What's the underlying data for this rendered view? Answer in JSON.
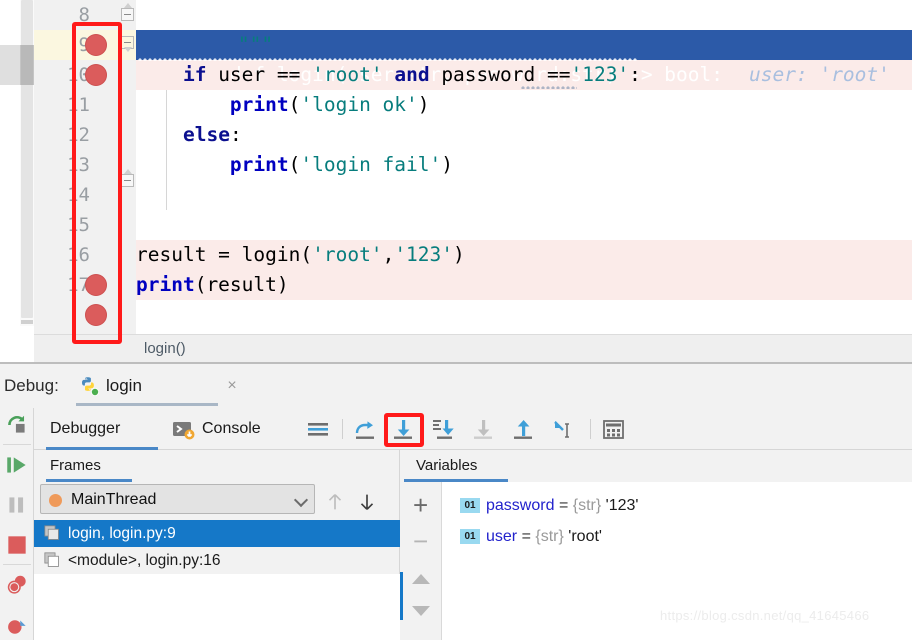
{
  "editor": {
    "lines": [
      {
        "num": "8",
        "text": "\"\"\"",
        "breakpoint": false,
        "state": "normal"
      },
      {
        "num": "9",
        "text": "def login(user:str, password:str) -> bool:",
        "breakpoint": true,
        "state": "executing",
        "inline_hint": "user: 'root'"
      },
      {
        "num": "10",
        "text": "    if user == 'root' and password =='123':",
        "breakpoint": true,
        "state": "breakpoint"
      },
      {
        "num": "11",
        "text": "        print('login ok')",
        "breakpoint": false,
        "state": "normal"
      },
      {
        "num": "12",
        "text": "    else:",
        "breakpoint": false,
        "state": "normal"
      },
      {
        "num": "13",
        "text": "        print('login fail')",
        "breakpoint": false,
        "state": "normal"
      },
      {
        "num": "14",
        "text": "",
        "breakpoint": false,
        "state": "normal"
      },
      {
        "num": "15",
        "text": "",
        "breakpoint": false,
        "state": "normal"
      },
      {
        "num": "16",
        "text": "result = login('root','123')",
        "breakpoint": true,
        "state": "breakpoint"
      },
      {
        "num": "17",
        "text": "print(result)",
        "breakpoint": true,
        "state": "breakpoint"
      }
    ],
    "breadcrumb": "login()",
    "colors": {
      "execution_line": "#2c5aa8",
      "breakpoint_line": "#fbebe9",
      "breakpoint_dot": "#db5c5c",
      "gutter_exec": "#fbf7e0"
    }
  },
  "debug": {
    "title_label": "Debug:",
    "run_config_name": "login",
    "close_label": "×",
    "tabs": [
      {
        "label": "Debugger",
        "active": true
      },
      {
        "label": "Console",
        "active": false
      }
    ],
    "toolbar_icons": [
      "show-execution-point-icon",
      "step-over-icon",
      "step-into-icon",
      "step-into-my-code-icon",
      "force-step-into-icon",
      "step-out-icon",
      "run-to-cursor-icon",
      "evaluate-expression-icon"
    ],
    "highlighted_toolbar_icon": "step-into-icon",
    "sidebar_icons": [
      "rerun-icon",
      "resume-program-icon",
      "pause-program-icon",
      "stop-icon",
      "mute-breakpoints-icon",
      "view-breakpoints-icon"
    ],
    "frames": {
      "header": "Frames",
      "thread": "MainThread",
      "items": [
        {
          "label": "login, login.py:9",
          "selected": true
        },
        {
          "label": "<module>, login.py:16",
          "selected": false
        }
      ]
    },
    "variables": {
      "header": "Variables",
      "add_label": "+",
      "remove_label": "−",
      "items": [
        {
          "badge": "01",
          "name": "password",
          "eq": "=",
          "type": "{str}",
          "value": "'123'"
        },
        {
          "badge": "01",
          "name": "user",
          "eq": "=",
          "type": "{str}",
          "value": "'root'"
        }
      ]
    }
  },
  "watermark": "https://blog.csdn.net/qq_41645466"
}
